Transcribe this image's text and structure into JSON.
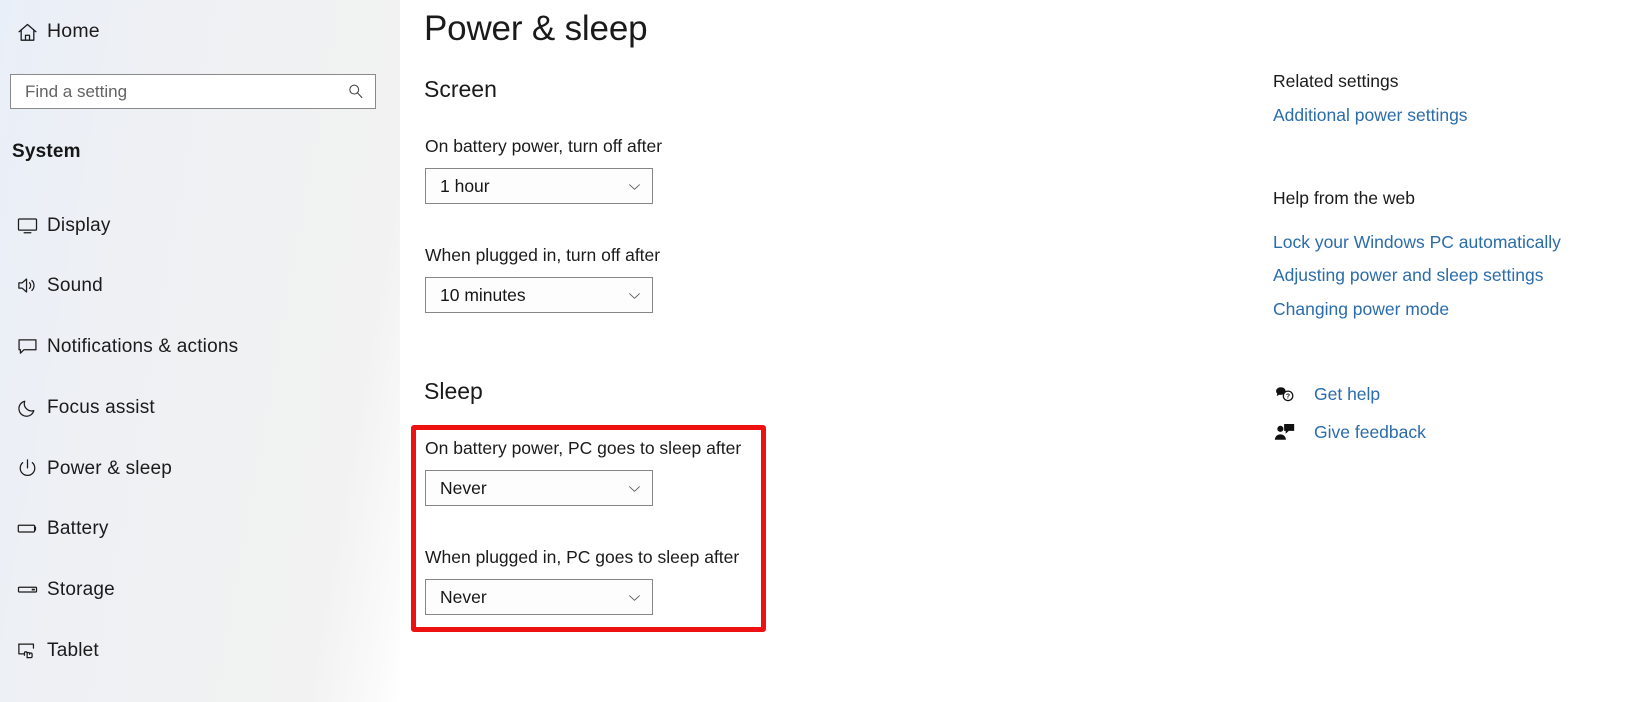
{
  "sidebar": {
    "home": {
      "label": "Home",
      "icon": "home-icon"
    },
    "search": {
      "placeholder": "Find a setting",
      "value": "",
      "icon": "search-icon"
    },
    "group_label": "System",
    "items": [
      {
        "label": "Display",
        "icon": "monitor-icon"
      },
      {
        "label": "Sound",
        "icon": "speaker-icon"
      },
      {
        "label": "Notifications & actions",
        "icon": "chat-bubble-icon"
      },
      {
        "label": "Focus assist",
        "icon": "moon-icon"
      },
      {
        "label": "Power & sleep",
        "icon": "power-icon"
      },
      {
        "label": "Battery",
        "icon": "battery-icon"
      },
      {
        "label": "Storage",
        "icon": "disk-icon"
      },
      {
        "label": "Tablet",
        "icon": "tablet-icon"
      }
    ]
  },
  "main": {
    "page_title": "Power & sleep",
    "sections": [
      {
        "heading": "Screen",
        "fields": [
          {
            "label": "On battery power, turn off after",
            "value": "1 hour"
          },
          {
            "label": "When plugged in, turn off after",
            "value": "10 minutes"
          }
        ]
      },
      {
        "heading": "Sleep",
        "fields": [
          {
            "label": "On battery power, PC goes to sleep after",
            "value": "Never"
          },
          {
            "label": "When plugged in, PC goes to sleep after",
            "value": "Never"
          }
        ]
      }
    ],
    "highlight_color": "#ee1111"
  },
  "right_panel": {
    "related_heading": "Related settings",
    "related_links": [
      "Additional power settings"
    ],
    "help_heading": "Help from the web",
    "help_links": [
      "Lock your Windows PC automatically",
      "Adjusting power and sleep settings",
      "Changing power mode"
    ],
    "actions": [
      {
        "label": "Get help",
        "icon": "help-bubble-icon"
      },
      {
        "label": "Give feedback",
        "icon": "feedback-person-icon"
      }
    ],
    "link_color": "#2b6cab"
  }
}
